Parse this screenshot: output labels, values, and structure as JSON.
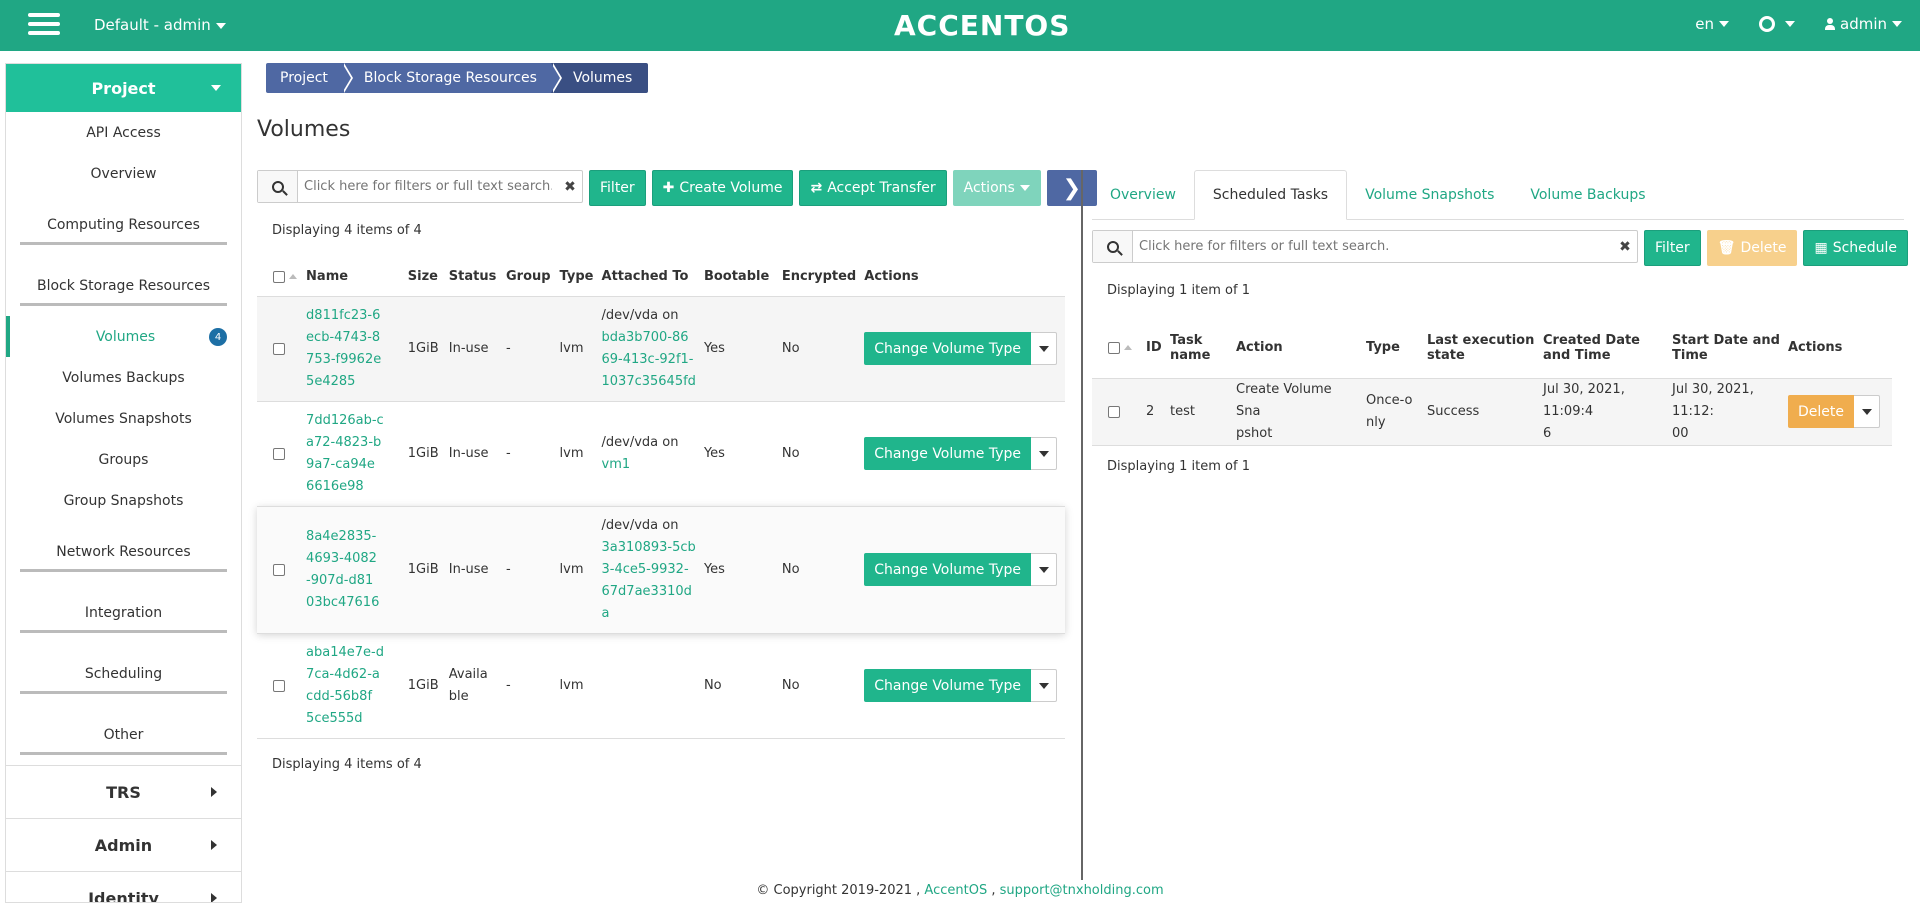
{
  "topbar": {
    "project_label": "Default - admin",
    "logo": "ACCENTOS",
    "lang": "en",
    "user": "admin",
    "icons": [
      "hamburger-icon",
      "gear-icon",
      "user-icon"
    ]
  },
  "sidebar": {
    "section_project": "Project",
    "items": [
      {
        "label": "API Access"
      },
      {
        "label": "Overview"
      },
      {
        "label": "Computing Resources"
      },
      {
        "label": "Block Storage Resources"
      },
      {
        "label": "Volumes",
        "badge": "4"
      },
      {
        "label": "Volumes Backups"
      },
      {
        "label": "Volumes Snapshots"
      },
      {
        "label": "Groups"
      },
      {
        "label": "Group Snapshots"
      },
      {
        "label": "Network Resources"
      },
      {
        "label": "Integration"
      },
      {
        "label": "Scheduling"
      },
      {
        "label": "Other"
      }
    ],
    "sections": [
      "TRS",
      "Admin",
      "Identity"
    ]
  },
  "breadcrumb": [
    "Project",
    "Block Storage Resources",
    "Volumes"
  ],
  "page_title": "Volumes",
  "volumes": {
    "search_placeholder": "Click here for filters or full text search.",
    "buttons": {
      "filter": "Filter",
      "create": "Create Volume",
      "accept": "Accept Transfer",
      "actions": "Actions"
    },
    "display_count": "Displaying 4 items of 4",
    "columns": [
      "Name",
      "Size",
      "Status",
      "Group",
      "Type",
      "Attached To",
      "Bootable",
      "Encrypted",
      "Actions"
    ],
    "rows": [
      {
        "name": [
          "d811fc23-6",
          "ecb-4743-8",
          "753-f9962e",
          "5e4285"
        ],
        "size": "1GiB",
        "status": [
          "In-use"
        ],
        "group": "-",
        "type": "lvm",
        "attached_prefix": "/dev/vda on",
        "attached_link": [
          "bda3b700-86",
          "69-413c-92f1-",
          "1037c35645fd"
        ],
        "bootable": "Yes",
        "encrypted": "No",
        "action": "Change Volume Type"
      },
      {
        "name": [
          "7dd126ab-c",
          "a72-4823-b",
          "9a7-ca94e",
          "6616e98"
        ],
        "size": "1GiB",
        "status": [
          "In-use"
        ],
        "group": "-",
        "type": "lvm",
        "attached_prefix": "/dev/vda on",
        "attached_link": [
          "vm1"
        ],
        "bootable": "Yes",
        "encrypted": "No",
        "action": "Change Volume Type"
      },
      {
        "name": [
          "8a4e2835-",
          "4693-4082",
          "-907d-d81",
          "03bc47616"
        ],
        "size": "1GiB",
        "status": [
          "In-use"
        ],
        "group": "-",
        "type": "lvm",
        "attached_prefix": "/dev/vda on",
        "attached_link": [
          "3a310893-5cb",
          "3-4ce5-9932-",
          "67d7ae3310d",
          "a"
        ],
        "bootable": "Yes",
        "encrypted": "No",
        "action": "Change Volume Type"
      },
      {
        "name": [
          "aba14e7e-d",
          "7ca-4d62-a",
          "cdd-56b8f",
          "5ce555d"
        ],
        "size": "1GiB",
        "status": [
          "Availa",
          "ble"
        ],
        "group": "-",
        "type": "lvm",
        "attached_prefix": "",
        "attached_link": [],
        "bootable": "No",
        "encrypted": "No",
        "action": "Change Volume Type"
      }
    ],
    "display_count_bottom": "Displaying 4 items of 4"
  },
  "detail": {
    "tabs": [
      "Overview",
      "Scheduled Tasks",
      "Volume Snapshots",
      "Volume Backups"
    ],
    "active_tab": "Scheduled Tasks",
    "search_placeholder": "Click here for filters or full text search.",
    "buttons": {
      "filter": "Filter",
      "delete": "Delete",
      "schedule": "Schedule"
    },
    "display_count": "Displaying 1 item of 1",
    "columns": [
      "ID",
      "Task name",
      "Action",
      "Type",
      "Last execution state",
      "Created Date and Time",
      "Start Date and Time",
      "Actions"
    ],
    "rows": [
      {
        "id": "2",
        "name": "test",
        "action": [
          "Create Volume Sna",
          "pshot"
        ],
        "type": [
          "Once-o",
          "nly"
        ],
        "state": "Success",
        "created": [
          "Jul 30, 2021, 11:09:4",
          "6"
        ],
        "start": [
          "Jul 30, 2021, 11:12:",
          "00"
        ],
        "action_btn": "Delete"
      }
    ],
    "display_count_bottom": "Displaying 1 item of 1"
  },
  "footer": {
    "copyright": "© Copyright 2019-2021 ,",
    "brand": "AccentOS",
    "sep": ",",
    "email": "support@tnxholding.com"
  }
}
